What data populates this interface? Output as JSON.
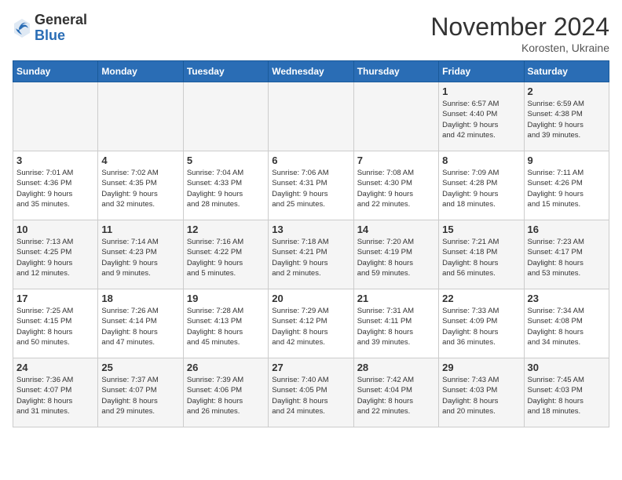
{
  "logo": {
    "general": "General",
    "blue": "Blue"
  },
  "title": "November 2024",
  "location": "Korosten, Ukraine",
  "days_of_week": [
    "Sunday",
    "Monday",
    "Tuesday",
    "Wednesday",
    "Thursday",
    "Friday",
    "Saturday"
  ],
  "weeks": [
    [
      {
        "day": "",
        "info": ""
      },
      {
        "day": "",
        "info": ""
      },
      {
        "day": "",
        "info": ""
      },
      {
        "day": "",
        "info": ""
      },
      {
        "day": "",
        "info": ""
      },
      {
        "day": "1",
        "info": "Sunrise: 6:57 AM\nSunset: 4:40 PM\nDaylight: 9 hours\nand 42 minutes."
      },
      {
        "day": "2",
        "info": "Sunrise: 6:59 AM\nSunset: 4:38 PM\nDaylight: 9 hours\nand 39 minutes."
      }
    ],
    [
      {
        "day": "3",
        "info": "Sunrise: 7:01 AM\nSunset: 4:36 PM\nDaylight: 9 hours\nand 35 minutes."
      },
      {
        "day": "4",
        "info": "Sunrise: 7:02 AM\nSunset: 4:35 PM\nDaylight: 9 hours\nand 32 minutes."
      },
      {
        "day": "5",
        "info": "Sunrise: 7:04 AM\nSunset: 4:33 PM\nDaylight: 9 hours\nand 28 minutes."
      },
      {
        "day": "6",
        "info": "Sunrise: 7:06 AM\nSunset: 4:31 PM\nDaylight: 9 hours\nand 25 minutes."
      },
      {
        "day": "7",
        "info": "Sunrise: 7:08 AM\nSunset: 4:30 PM\nDaylight: 9 hours\nand 22 minutes."
      },
      {
        "day": "8",
        "info": "Sunrise: 7:09 AM\nSunset: 4:28 PM\nDaylight: 9 hours\nand 18 minutes."
      },
      {
        "day": "9",
        "info": "Sunrise: 7:11 AM\nSunset: 4:26 PM\nDaylight: 9 hours\nand 15 minutes."
      }
    ],
    [
      {
        "day": "10",
        "info": "Sunrise: 7:13 AM\nSunset: 4:25 PM\nDaylight: 9 hours\nand 12 minutes."
      },
      {
        "day": "11",
        "info": "Sunrise: 7:14 AM\nSunset: 4:23 PM\nDaylight: 9 hours\nand 9 minutes."
      },
      {
        "day": "12",
        "info": "Sunrise: 7:16 AM\nSunset: 4:22 PM\nDaylight: 9 hours\nand 5 minutes."
      },
      {
        "day": "13",
        "info": "Sunrise: 7:18 AM\nSunset: 4:21 PM\nDaylight: 9 hours\nand 2 minutes."
      },
      {
        "day": "14",
        "info": "Sunrise: 7:20 AM\nSunset: 4:19 PM\nDaylight: 8 hours\nand 59 minutes."
      },
      {
        "day": "15",
        "info": "Sunrise: 7:21 AM\nSunset: 4:18 PM\nDaylight: 8 hours\nand 56 minutes."
      },
      {
        "day": "16",
        "info": "Sunrise: 7:23 AM\nSunset: 4:17 PM\nDaylight: 8 hours\nand 53 minutes."
      }
    ],
    [
      {
        "day": "17",
        "info": "Sunrise: 7:25 AM\nSunset: 4:15 PM\nDaylight: 8 hours\nand 50 minutes."
      },
      {
        "day": "18",
        "info": "Sunrise: 7:26 AM\nSunset: 4:14 PM\nDaylight: 8 hours\nand 47 minutes."
      },
      {
        "day": "19",
        "info": "Sunrise: 7:28 AM\nSunset: 4:13 PM\nDaylight: 8 hours\nand 45 minutes."
      },
      {
        "day": "20",
        "info": "Sunrise: 7:29 AM\nSunset: 4:12 PM\nDaylight: 8 hours\nand 42 minutes."
      },
      {
        "day": "21",
        "info": "Sunrise: 7:31 AM\nSunset: 4:11 PM\nDaylight: 8 hours\nand 39 minutes."
      },
      {
        "day": "22",
        "info": "Sunrise: 7:33 AM\nSunset: 4:09 PM\nDaylight: 8 hours\nand 36 minutes."
      },
      {
        "day": "23",
        "info": "Sunrise: 7:34 AM\nSunset: 4:08 PM\nDaylight: 8 hours\nand 34 minutes."
      }
    ],
    [
      {
        "day": "24",
        "info": "Sunrise: 7:36 AM\nSunset: 4:07 PM\nDaylight: 8 hours\nand 31 minutes."
      },
      {
        "day": "25",
        "info": "Sunrise: 7:37 AM\nSunset: 4:07 PM\nDaylight: 8 hours\nand 29 minutes."
      },
      {
        "day": "26",
        "info": "Sunrise: 7:39 AM\nSunset: 4:06 PM\nDaylight: 8 hours\nand 26 minutes."
      },
      {
        "day": "27",
        "info": "Sunrise: 7:40 AM\nSunset: 4:05 PM\nDaylight: 8 hours\nand 24 minutes."
      },
      {
        "day": "28",
        "info": "Sunrise: 7:42 AM\nSunset: 4:04 PM\nDaylight: 8 hours\nand 22 minutes."
      },
      {
        "day": "29",
        "info": "Sunrise: 7:43 AM\nSunset: 4:03 PM\nDaylight: 8 hours\nand 20 minutes."
      },
      {
        "day": "30",
        "info": "Sunrise: 7:45 AM\nSunset: 4:03 PM\nDaylight: 8 hours\nand 18 minutes."
      }
    ]
  ]
}
